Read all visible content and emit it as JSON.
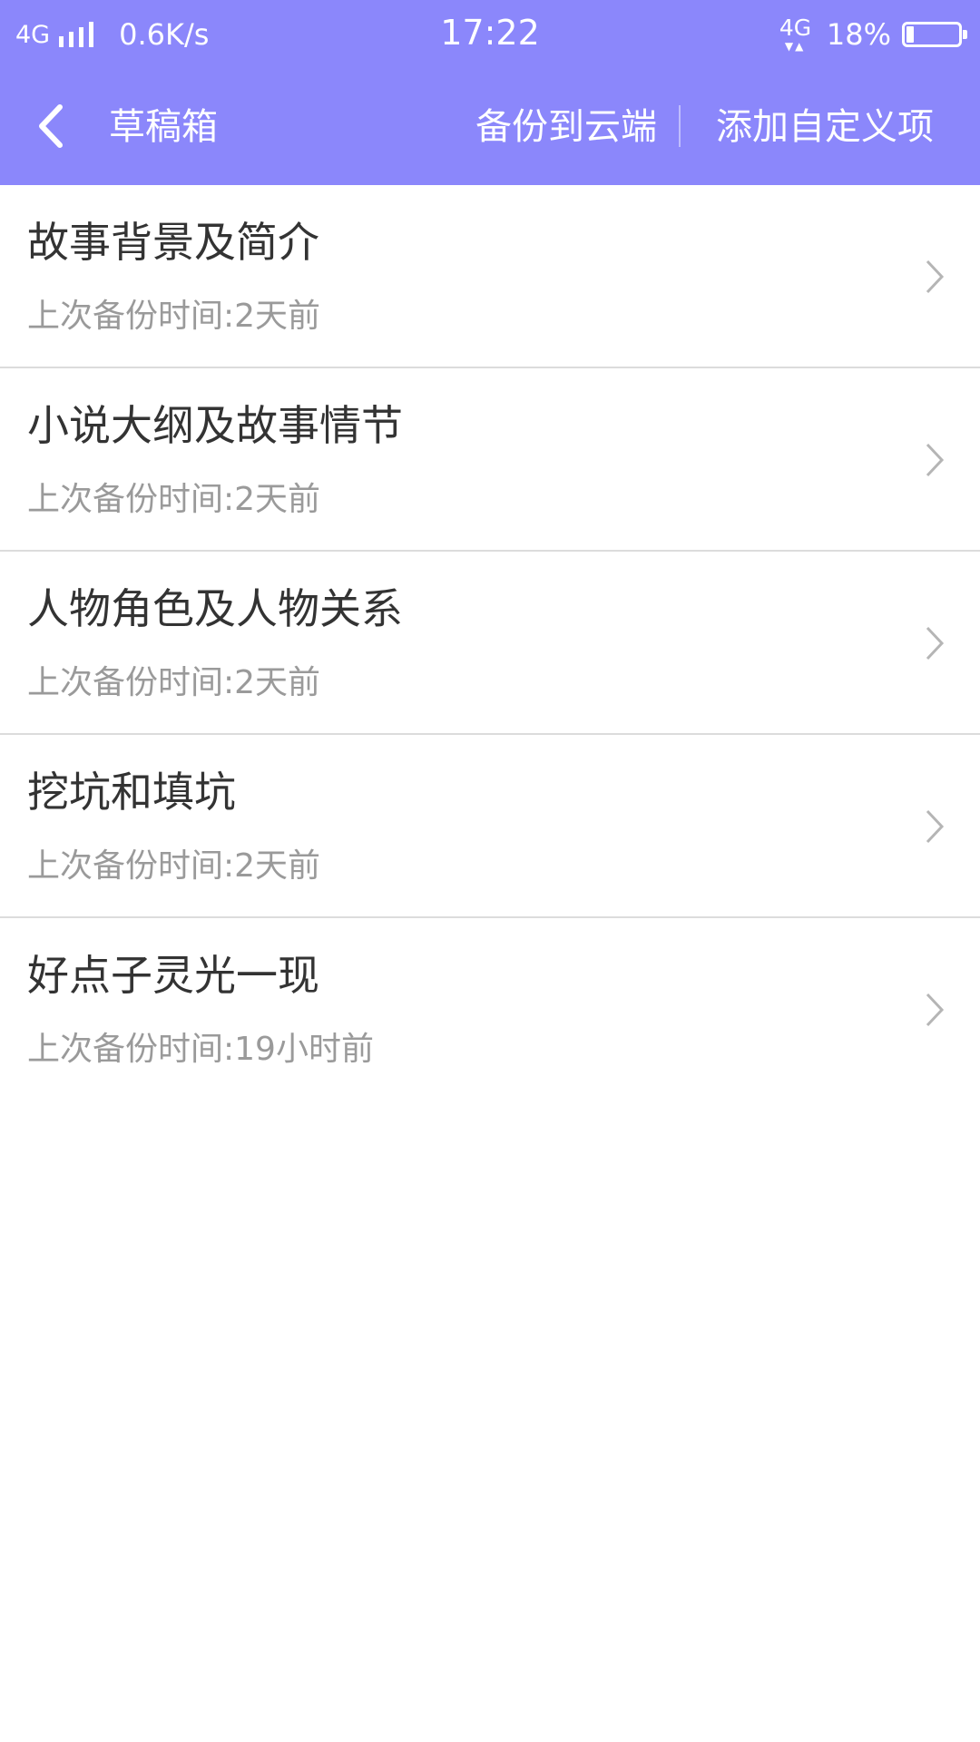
{
  "status_bar": {
    "network_left": "4G",
    "speed": "0.6K/s",
    "time": "17:22",
    "network_right": "4G",
    "battery": "18%"
  },
  "nav": {
    "back_icon": "chevron-left-icon",
    "title": "草稿箱",
    "backup_label": "备份到云端",
    "add_label": "添加自定义项"
  },
  "colors": {
    "header_bg": "#8b87fb",
    "title_text": "#333333",
    "subtitle_text": "#9a9a9a",
    "divider": "#dcdcdc",
    "chevron": "#b5b5b5"
  },
  "items": [
    {
      "title": "故事背景及简介",
      "subtitle": "上次备份时间:2天前"
    },
    {
      "title": "小说大纲及故事情节",
      "subtitle": "上次备份时间:2天前"
    },
    {
      "title": "人物角色及人物关系",
      "subtitle": "上次备份时间:2天前"
    },
    {
      "title": "挖坑和填坑",
      "subtitle": "上次备份时间:2天前"
    },
    {
      "title": "好点子灵光一现",
      "subtitle": "上次备份时间:19小时前"
    }
  ]
}
